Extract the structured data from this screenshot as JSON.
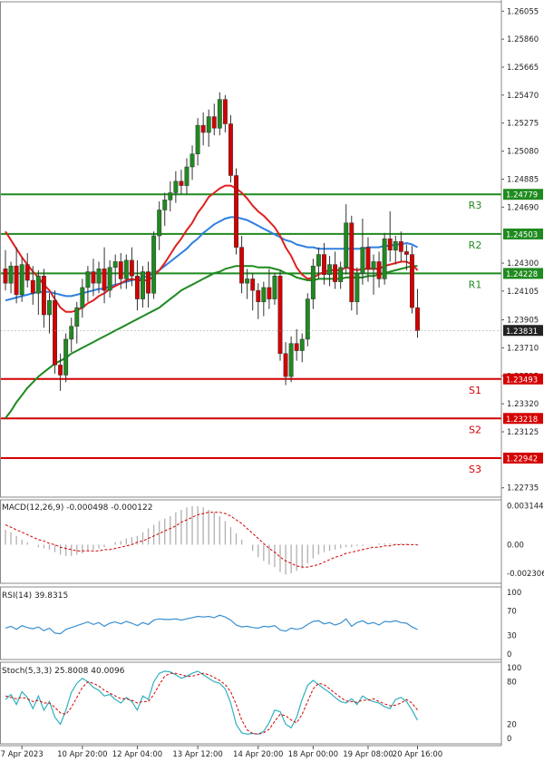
{
  "chart_data": {
    "type": "candlestick",
    "symbol_bias": "GBPUSD-like price chart",
    "colors": {
      "bull": "#1f8a1f",
      "bear": "#d40000",
      "ema_red": "#e02020",
      "ema_blue": "#2f80e0",
      "ema_green": "#1f8a1f",
      "resistance": "#1f8a1f",
      "support": "#d40000",
      "label_bg_green": "#1f8a1f",
      "label_bg_red": "#d40000",
      "price_bg": "#222222",
      "rsi_line": "#3a8fd0",
      "stoch_main": "#30b0c0",
      "stoch_signal": "#d40000",
      "macd_hist": "#b0b0b0",
      "macd_signal": "#d40000"
    },
    "price_axis": {
      "ticks": [
        "1.26055",
        "1.25860",
        "1.25665",
        "1.25470",
        "1.25275",
        "1.25080",
        "1.24885",
        "1.24690",
        "1.24300",
        "1.24105",
        "1.23905",
        "1.23710",
        "1.23515",
        "1.23320",
        "1.23125",
        "1.22735"
      ],
      "tick_values": [
        1.26055,
        1.2586,
        1.25665,
        1.2547,
        1.25275,
        1.2508,
        1.24885,
        1.2469,
        1.243,
        1.24105,
        1.23905,
        1.2371,
        1.23515,
        1.2332,
        1.23125,
        1.22735
      ],
      "ylim": [
        1.2267,
        1.2612
      ]
    },
    "levels": [
      {
        "name": "R3",
        "value": 1.24779,
        "label": "1.24779",
        "kind": "resistance"
      },
      {
        "name": "R2",
        "value": 1.24503,
        "label": "1.24503",
        "kind": "resistance"
      },
      {
        "name": "R1",
        "value": 1.24228,
        "label": "1.24228",
        "kind": "resistance"
      },
      {
        "name": "S1",
        "value": 1.23493,
        "label": "1.23493",
        "kind": "support"
      },
      {
        "name": "S2",
        "value": 1.23218,
        "label": "1.23218",
        "kind": "support"
      },
      {
        "name": "S3",
        "value": 1.22942,
        "label": "1.22942",
        "kind": "support"
      }
    ],
    "current_price": {
      "value": 1.23831,
      "label": "1.23831"
    },
    "candles": [
      [
        1.2426,
        1.2439,
        1.2411,
        1.2416
      ],
      [
        1.2416,
        1.2431,
        1.2409,
        1.2428
      ],
      [
        1.2428,
        1.2441,
        1.2402,
        1.2408
      ],
      [
        1.2408,
        1.2434,
        1.2403,
        1.2429
      ],
      [
        1.2429,
        1.2437,
        1.2413,
        1.2418
      ],
      [
        1.2418,
        1.2428,
        1.2401,
        1.2409
      ],
      [
        1.2409,
        1.2425,
        1.2394,
        1.2421
      ],
      [
        1.2421,
        1.2426,
        1.2385,
        1.2394
      ],
      [
        1.2394,
        1.2409,
        1.2381,
        1.2404
      ],
      [
        1.2404,
        1.2411,
        1.2353,
        1.2359
      ],
      [
        1.2359,
        1.2367,
        1.2341,
        1.2352
      ],
      [
        1.2352,
        1.2381,
        1.2347,
        1.2377
      ],
      [
        1.2377,
        1.2392,
        1.2368,
        1.2386
      ],
      [
        1.2386,
        1.2403,
        1.2374,
        1.2399
      ],
      [
        1.2399,
        1.2419,
        1.2392,
        1.2413
      ],
      [
        1.2413,
        1.2428,
        1.2403,
        1.2424
      ],
      [
        1.2424,
        1.2433,
        1.2407,
        1.2416
      ],
      [
        1.2416,
        1.2431,
        1.2409,
        1.2426
      ],
      [
        1.2426,
        1.2441,
        1.2402,
        1.2411
      ],
      [
        1.2411,
        1.2432,
        1.2406,
        1.2427
      ],
      [
        1.2427,
        1.2436,
        1.2415,
        1.2431
      ],
      [
        1.2431,
        1.2437,
        1.2412,
        1.2419
      ],
      [
        1.2419,
        1.2436,
        1.2412,
        1.2432
      ],
      [
        1.2432,
        1.2441,
        1.2414,
        1.2421
      ],
      [
        1.2421,
        1.2432,
        1.2397,
        1.2405
      ],
      [
        1.2405,
        1.2428,
        1.2399,
        1.2424
      ],
      [
        1.2424,
        1.2431,
        1.2399,
        1.2409
      ],
      [
        1.2409,
        1.2452,
        1.2405,
        1.2449
      ],
      [
        1.2449,
        1.2473,
        1.2439,
        1.2467
      ],
      [
        1.2467,
        1.2479,
        1.2456,
        1.2474
      ],
      [
        1.2474,
        1.2487,
        1.2466,
        1.2479
      ],
      [
        1.2479,
        1.2494,
        1.2472,
        1.2487
      ],
      [
        1.2487,
        1.2495,
        1.2478,
        1.2484
      ],
      [
        1.2484,
        1.2503,
        1.2478,
        1.2497
      ],
      [
        1.2497,
        1.2512,
        1.2488,
        1.2506
      ],
      [
        1.2506,
        1.2531,
        1.2498,
        1.2526
      ],
      [
        1.2526,
        1.2535,
        1.2512,
        1.2521
      ],
      [
        1.2521,
        1.2537,
        1.2511,
        1.2532
      ],
      [
        1.2532,
        1.2541,
        1.2519,
        1.2524
      ],
      [
        1.2524,
        1.2549,
        1.2519,
        1.2544
      ],
      [
        1.2544,
        1.2547,
        1.2521,
        1.2527
      ],
      [
        1.2527,
        1.2533,
        1.2486,
        1.2491
      ],
      [
        1.2491,
        1.2496,
        1.2436,
        1.2441
      ],
      [
        1.2441,
        1.2449,
        1.2409,
        1.2416
      ],
      [
        1.2416,
        1.2426,
        1.2405,
        1.2419
      ],
      [
        1.2419,
        1.2423,
        1.2397,
        1.2411
      ],
      [
        1.2411,
        1.2416,
        1.2391,
        1.2403
      ],
      [
        1.2403,
        1.2417,
        1.2393,
        1.2413
      ],
      [
        1.2413,
        1.2426,
        1.2398,
        1.2405
      ],
      [
        1.2405,
        1.2423,
        1.2401,
        1.2421
      ],
      [
        1.2421,
        1.2425,
        1.2362,
        1.2367
      ],
      [
        1.2367,
        1.2375,
        1.2345,
        1.2351
      ],
      [
        1.2351,
        1.2379,
        1.2347,
        1.2374
      ],
      [
        1.2374,
        1.2384,
        1.2362,
        1.2369
      ],
      [
        1.2369,
        1.2381,
        1.2361,
        1.2377
      ],
      [
        1.2377,
        1.2409,
        1.2372,
        1.2405
      ],
      [
        1.2405,
        1.2433,
        1.2398,
        1.2428
      ],
      [
        1.2428,
        1.2441,
        1.2419,
        1.2436
      ],
      [
        1.2436,
        1.2444,
        1.2415,
        1.2422
      ],
      [
        1.2422,
        1.2435,
        1.2414,
        1.2429
      ],
      [
        1.2429,
        1.2438,
        1.2412,
        1.2417
      ],
      [
        1.2417,
        1.2431,
        1.2412,
        1.2427
      ],
      [
        1.2427,
        1.2471,
        1.2422,
        1.2458
      ],
      [
        1.2458,
        1.2463,
        1.2397,
        1.2403
      ],
      [
        1.2403,
        1.2427,
        1.2394,
        1.2423
      ],
      [
        1.2423,
        1.2461,
        1.2415,
        1.2441
      ],
      [
        1.2441,
        1.2448,
        1.2417,
        1.2426
      ],
      [
        1.2426,
        1.2436,
        1.2408,
        1.2431
      ],
      [
        1.2431,
        1.2438,
        1.2413,
        1.2419
      ],
      [
        1.2419,
        1.2451,
        1.2415,
        1.2447
      ],
      [
        1.2447,
        1.2466,
        1.2431,
        1.2439
      ],
      [
        1.2439,
        1.2449,
        1.2429,
        1.2445
      ],
      [
        1.2445,
        1.2452,
        1.2431,
        1.2438
      ],
      [
        1.2438,
        1.2443,
        1.2425,
        1.2436
      ],
      [
        1.2436,
        1.2442,
        1.2395,
        1.2399
      ],
      [
        1.2399,
        1.2412,
        1.2378,
        1.2383
      ]
    ],
    "ema_fast_red": [
      1.2452,
      1.2446,
      1.244,
      1.2434,
      1.2429,
      1.2424,
      1.242,
      1.2415,
      1.2411,
      1.2405,
      1.2399,
      1.2396,
      1.2396,
      1.2397,
      1.2399,
      1.2402,
      1.2404,
      1.2407,
      1.2409,
      1.2412,
      1.2414,
      1.2416,
      1.2418,
      1.2419,
      1.2418,
      1.2418,
      1.2418,
      1.2421,
      1.2425,
      1.243,
      1.2436,
      1.2442,
      1.2447,
      1.2453,
      1.2458,
      1.2465,
      1.247,
      1.2476,
      1.2479,
      1.2482,
      1.2484,
      1.2484,
      1.2482,
      1.2479,
      1.2475,
      1.247,
      1.2466,
      1.2463,
      1.2459,
      1.2455,
      1.2449,
      1.2441,
      1.2435,
      1.2427,
      1.2422,
      1.2419,
      1.242,
      1.2422,
      1.2424,
      1.2425,
      1.2425,
      1.2425,
      1.2427,
      1.2426,
      1.2425,
      1.2426,
      1.2426,
      1.2426,
      1.2426,
      1.2428,
      1.2429,
      1.243,
      1.2431,
      1.2431,
      1.2429,
      1.2425
    ],
    "ema_mid_blue": [
      1.2404,
      1.2405,
      1.2406,
      1.2407,
      1.2408,
      1.2409,
      1.241,
      1.241,
      1.241,
      1.2409,
      1.2408,
      1.2407,
      1.2407,
      1.2408,
      1.2409,
      1.241,
      1.2411,
      1.2412,
      1.2412,
      1.2414,
      1.2415,
      1.2416,
      1.2417,
      1.2418,
      1.2419,
      1.242,
      1.2421,
      1.2423,
      1.2425,
      1.2428,
      1.2431,
      1.2434,
      1.2437,
      1.244,
      1.2444,
      1.2447,
      1.2451,
      1.2454,
      1.2457,
      1.2459,
      1.2461,
      1.2462,
      1.2462,
      1.2461,
      1.246,
      1.2458,
      1.2456,
      1.2454,
      1.2452,
      1.245,
      1.2448,
      1.2446,
      1.2445,
      1.2443,
      1.2442,
      1.2441,
      1.2441,
      1.244,
      1.244,
      1.244,
      1.244,
      1.244,
      1.244,
      1.244,
      1.244,
      1.244,
      1.2441,
      1.2441,
      1.2441,
      1.2442,
      1.2442,
      1.2443,
      1.2443,
      1.2444,
      1.2443,
      1.2441
    ],
    "ema_slow_green": [
      1.2322,
      1.2327,
      1.2333,
      1.2338,
      1.2343,
      1.2347,
      1.2351,
      1.2354,
      1.2357,
      1.236,
      1.2362,
      1.2364,
      1.2367,
      1.2369,
      1.2371,
      1.2373,
      1.2375,
      1.2377,
      1.2379,
      1.2381,
      1.2383,
      1.2385,
      1.2387,
      1.2389,
      1.2391,
      1.2393,
      1.2395,
      1.2397,
      1.2399,
      1.2402,
      1.2405,
      1.2408,
      1.2411,
      1.2413,
      1.2415,
      1.2417,
      1.2419,
      1.2421,
      1.2423,
      1.2424,
      1.2426,
      1.2427,
      1.2428,
      1.2428,
      1.2428,
      1.2428,
      1.2427,
      1.2427,
      1.2427,
      1.2426,
      1.2425,
      1.2423,
      1.2422,
      1.242,
      1.2419,
      1.2418,
      1.2418,
      1.2419,
      1.2419,
      1.2419,
      1.2419,
      1.2419,
      1.242,
      1.242,
      1.242,
      1.242,
      1.2421,
      1.2421,
      1.2422,
      1.2423,
      1.2424,
      1.2425,
      1.2426,
      1.2427,
      1.2428,
      1.2428
    ],
    "x_labels": [
      {
        "text": "7 Apr 2023",
        "at": 3
      },
      {
        "text": "10 Apr 20:00",
        "at": 14
      },
      {
        "text": "12 Apr 04:00",
        "at": 24
      },
      {
        "text": "13 Apr 12:00",
        "at": 35
      },
      {
        "text": "14 Apr 20:00",
        "at": 46
      },
      {
        "text": "18 Apr 00:00",
        "at": 56
      },
      {
        "text": "19 Apr 08:00",
        "at": 66
      },
      {
        "text": "20 Apr 16:00",
        "at": 75
      }
    ],
    "macd": {
      "label": "MACD(12,26,9) -0.000498 -0.000122",
      "axis_ticks": [
        "0.003144",
        "0.00",
        "-0.002306"
      ],
      "axis_values": [
        0.003144,
        0.0,
        -0.002306
      ],
      "ylim": [
        -0.0031,
        0.0036
      ],
      "histogram": [
        0.0012,
        0.001,
        0.0007,
        0.0004,
        0.0002,
        0.0,
        -0.0002,
        -0.0003,
        -0.0004,
        -0.0006,
        -0.0008,
        -0.0009,
        -0.0009,
        -0.0008,
        -0.0007,
        -0.0005,
        -0.0004,
        -0.0003,
        -0.0002,
        0.0,
        0.0002,
        0.0003,
        0.0005,
        0.0006,
        0.0007,
        0.001,
        0.0013,
        0.0016,
        0.0019,
        0.0021,
        0.0023,
        0.0026,
        0.0028,
        0.003,
        0.0031,
        0.0031,
        0.003,
        0.0028,
        0.0026,
        0.0023,
        0.0019,
        0.0014,
        0.0009,
        0.0004,
        0.0,
        -0.0005,
        -0.001,
        -0.0013,
        -0.0016,
        -0.0018,
        -0.0022,
        -0.0024,
        -0.0023,
        -0.0021,
        -0.0019,
        -0.0015,
        -0.0011,
        -0.0008,
        -0.0006,
        -0.0005,
        -0.0004,
        -0.0003,
        -0.0002,
        -0.0002,
        -0.0001,
        -0.0001,
        0.0,
        0.0,
        0.0001,
        0.0001,
        0.0001,
        0.0001,
        0.0001,
        0.0001,
        0.0,
        -0.0001
      ],
      "signal": [
        0.0016,
        0.0014,
        0.0012,
        0.001,
        0.0008,
        0.0006,
        0.0004,
        0.0003,
        0.0001,
        0.0,
        -0.0002,
        -0.0003,
        -0.0004,
        -0.0005,
        -0.0005,
        -0.0005,
        -0.0005,
        -0.0005,
        -0.0004,
        -0.0004,
        -0.0003,
        -0.0002,
        -0.0001,
        0.0,
        0.0002,
        0.0003,
        0.0005,
        0.0007,
        0.0009,
        0.0011,
        0.0013,
        0.0015,
        0.0018,
        0.002,
        0.0022,
        0.0024,
        0.0025,
        0.0026,
        0.0026,
        0.0026,
        0.0025,
        0.0023,
        0.002,
        0.0017,
        0.0013,
        0.0009,
        0.0005,
        0.0001,
        -0.0003,
        -0.0006,
        -0.001,
        -0.0013,
        -0.0015,
        -0.0017,
        -0.0018,
        -0.0018,
        -0.0017,
        -0.0016,
        -0.0014,
        -0.0012,
        -0.001,
        -0.0009,
        -0.0007,
        -0.0006,
        -0.0005,
        -0.0004,
        -0.0003,
        -0.0002,
        -0.0002,
        -0.0001,
        -0.0001,
        0.0,
        0.0,
        0.0,
        0.0,
        0.0
      ]
    },
    "rsi": {
      "label": "RSI(14) 39.8315",
      "axis_ticks": [
        "100",
        "70",
        "30",
        "0"
      ],
      "axis_values": [
        100,
        70,
        30,
        0
      ],
      "ylim": [
        0,
        100
      ],
      "values": [
        42,
        45,
        40,
        46,
        43,
        41,
        44,
        38,
        42,
        34,
        33,
        40,
        43,
        46,
        49,
        52,
        48,
        51,
        45,
        50,
        52,
        49,
        53,
        50,
        46,
        51,
        48,
        55,
        57,
        56,
        56,
        57,
        55,
        57,
        59,
        61,
        60,
        61,
        59,
        63,
        60,
        55,
        47,
        44,
        45,
        43,
        42,
        45,
        44,
        46,
        39,
        37,
        42,
        40,
        42,
        48,
        53,
        54,
        49,
        51,
        47,
        50,
        57,
        45,
        51,
        54,
        49,
        51,
        47,
        53,
        52,
        54,
        51,
        50,
        44,
        39.8
      ]
    },
    "stoch": {
      "label": "Stoch(5,3,3) 25.8008 40.0096",
      "axis_ticks": [
        "100",
        "80",
        "20",
        "0"
      ],
      "axis_values": [
        100,
        80,
        20,
        0
      ],
      "ylim": [
        0,
        100
      ],
      "main": [
        55,
        62,
        48,
        66,
        58,
        42,
        60,
        40,
        52,
        30,
        20,
        40,
        65,
        78,
        85,
        80,
        72,
        68,
        60,
        62,
        55,
        50,
        58,
        52,
        40,
        60,
        55,
        80,
        92,
        95,
        94,
        90,
        85,
        88,
        92,
        95,
        90,
        85,
        80,
        78,
        70,
        50,
        20,
        8,
        6,
        7,
        6,
        10,
        22,
        40,
        38,
        20,
        15,
        30,
        55,
        75,
        82,
        76,
        70,
        65,
        58,
        52,
        50,
        56,
        48,
        60,
        55,
        52,
        50,
        45,
        42,
        55,
        58,
        52,
        40,
        25.8
      ],
      "signal": [
        60,
        58,
        56,
        58,
        56,
        52,
        54,
        50,
        50,
        44,
        36,
        34,
        44,
        58,
        72,
        80,
        78,
        74,
        68,
        64,
        60,
        56,
        56,
        54,
        50,
        52,
        52,
        62,
        76,
        88,
        92,
        92,
        90,
        88,
        88,
        90,
        92,
        90,
        86,
        82,
        76,
        66,
        48,
        26,
        12,
        7,
        6,
        8,
        13,
        24,
        34,
        32,
        26,
        22,
        34,
        52,
        70,
        78,
        76,
        70,
        64,
        58,
        53,
        52,
        51,
        54,
        54,
        56,
        52,
        49,
        46,
        47,
        50,
        55,
        50,
        40
      ]
    }
  }
}
